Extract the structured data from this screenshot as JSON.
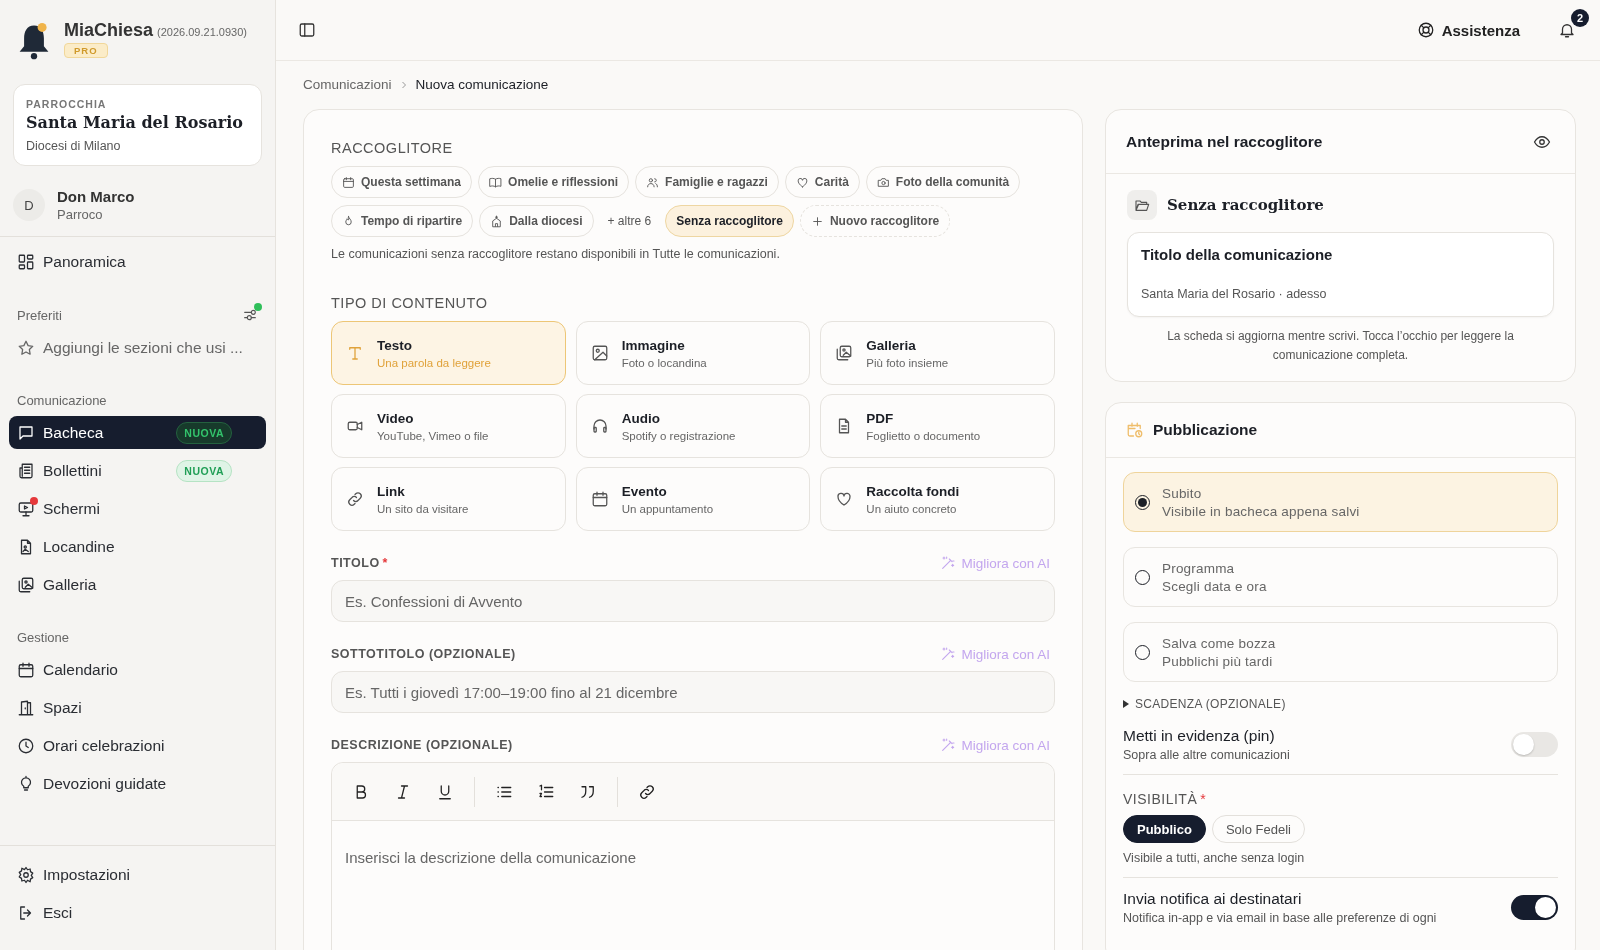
{
  "app": {
    "name": "MiaChiesa",
    "version": "(2026.09.21.0930)",
    "plan": "PRO"
  },
  "parish": {
    "label": "PARROCCHIA",
    "name": "Santa Maria del Rosario",
    "diocese": "Diocesi di Milano"
  },
  "user": {
    "initial": "D",
    "name": "Don Marco",
    "role": "Parroco"
  },
  "sidebar": {
    "overview": {
      "label": "Panoramica",
      "selected": false
    },
    "favorites": {
      "title": "Preferiti",
      "has_update": true,
      "hint": "Aggiungi le sezioni che usi ..."
    },
    "sections": [
      {
        "title": "Comunicazione",
        "items": [
          {
            "label": "Bacheca",
            "selected": true,
            "badge": "NUOVA",
            "alert": false
          },
          {
            "label": "Bollettini",
            "selected": false,
            "badge": "NUOVA",
            "alert": false
          },
          {
            "label": "Schermi",
            "selected": false,
            "alert": true
          },
          {
            "label": "Locandine",
            "selected": false,
            "alert": false
          },
          {
            "label": "Galleria",
            "selected": false,
            "alert": false
          }
        ]
      },
      {
        "title": "Gestione",
        "items": [
          {
            "label": "Calendario",
            "selected": false,
            "alert": false
          },
          {
            "label": "Spazi",
            "selected": false,
            "alert": false
          },
          {
            "label": "Orari celebrazioni",
            "selected": false,
            "alert": false
          },
          {
            "label": "Devozioni guidate",
            "selected": false,
            "alert": false
          }
        ]
      }
    ],
    "footer": [
      {
        "label": "Impostazioni"
      },
      {
        "label": "Esci"
      }
    ]
  },
  "topbar": {
    "help": "Assistenza",
    "notifications": "2"
  },
  "breadcrumb": [
    "Comunicazioni",
    "Nuova comunicazione"
  ],
  "form": {
    "collections": {
      "title": "RACCOGLITORE",
      "chips": [
        {
          "label": "Questa settimana",
          "kind": "collection",
          "selected": false
        },
        {
          "label": "Omelie e riflessioni",
          "kind": "collection",
          "selected": false
        },
        {
          "label": "Famiglie e ragazzi",
          "kind": "collection",
          "selected": false
        },
        {
          "label": "Carità",
          "kind": "collection",
          "selected": false
        },
        {
          "label": "Foto della comunità",
          "kind": "collection",
          "selected": false
        },
        {
          "label": "Tempo di ripartire",
          "kind": "collection",
          "selected": false
        },
        {
          "label": "Dalla diocesi",
          "kind": "collection",
          "selected": false
        },
        {
          "label": "+ altre 6",
          "kind": "more"
        },
        {
          "label": "Senza raccoglitore",
          "kind": "collection",
          "selected": true
        },
        {
          "label": "Nuovo raccoglitore",
          "kind": "new"
        }
      ],
      "hint": "Le comunicazioni senza raccoglitore restano disponibili in Tutte le comunicazioni."
    },
    "content_type": {
      "title": "TIPO DI CONTENUTO",
      "options": [
        {
          "label": "Testo",
          "description": "Una parola da leggere",
          "selected": true
        },
        {
          "label": "Immagine",
          "description": "Foto o locandina",
          "selected": false
        },
        {
          "label": "Galleria",
          "description": "Più foto insieme",
          "selected": false
        },
        {
          "label": "Video",
          "description": "YouTube, Vimeo o file",
          "selected": false
        },
        {
          "label": "Audio",
          "description": "Spotify o registrazione",
          "selected": false
        },
        {
          "label": "PDF",
          "description": "Foglietto o documento",
          "selected": false
        },
        {
          "label": "Link",
          "description": "Un sito da visitare",
          "selected": false
        },
        {
          "label": "Evento",
          "description": "Un appuntamento",
          "selected": false
        },
        {
          "label": "Raccolta fondi",
          "description": "Un aiuto concreto",
          "selected": false
        }
      ]
    },
    "fields": [
      {
        "label": "TITOLO",
        "required_mark": "*",
        "ai": "Migliora con AI",
        "placeholder": "Es. Confessioni di Avvento"
      },
      {
        "label": "SOTTOTITOLO (OPZIONALE)",
        "ai": "Migliora con AI",
        "placeholder": "Es. Tutti i giovedì 17:00–19:00 fino al 21 dicembre"
      }
    ],
    "description": {
      "label": "DESCRIZIONE (OPZIONALE)",
      "ai": "Migliora con AI",
      "placeholder": "Inserisci la descrizione della comunicazione"
    }
  },
  "preview": {
    "title": "Anteprima nel raccoglitore",
    "collection": "Senza raccoglitore",
    "card_title": "Titolo della comunicazione",
    "card_meta": "Santa Maria del Rosario · adesso",
    "hint": "La scheda si aggiorna mentre scrivi. Tocca l’occhio per leggere la comunicazione completa."
  },
  "publication": {
    "title": "Pubblicazione",
    "options": [
      {
        "label": "Subito",
        "description": "Visibile in bacheca appena salvi",
        "selected": true
      },
      {
        "label": "Programma",
        "description": "Scegli data e ora",
        "selected": false
      },
      {
        "label": "Salva come bozza",
        "description": "Pubblichi più tardi",
        "selected": false
      }
    ],
    "expiry": {
      "label": "SCADENZA (OPZIONALE)",
      "expanded": false
    },
    "pin": {
      "label": "Metti in evidenza (pin)",
      "description": "Sopra alle altre comunicazioni",
      "on": false
    },
    "visibility": {
      "label": "VISIBILITÀ",
      "required_mark": "*",
      "options": [
        {
          "label": "Pubblico",
          "selected": true
        },
        {
          "label": "Solo Fedeli",
          "selected": false
        }
      ],
      "hint": "Visibile a tutti, anche senza login"
    },
    "notify": {
      "label": "Invia notifica ai destinatari",
      "description": "Notifica in-app e via email in base alle preferenze di ogni",
      "on": true
    }
  }
}
